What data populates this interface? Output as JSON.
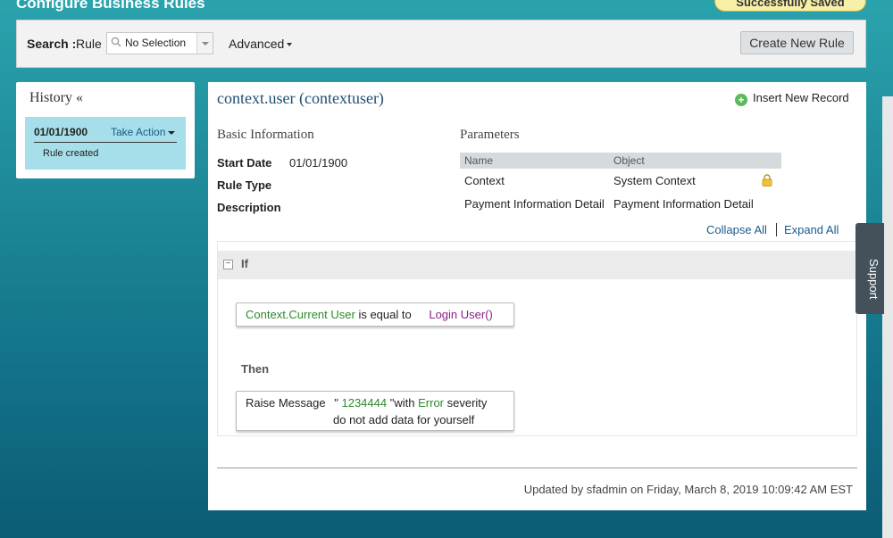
{
  "page": {
    "title": "Configure Business Rules",
    "saved_badge": "Successfully Saved"
  },
  "search": {
    "label": "Search :",
    "rule_label": "Rule",
    "select_value": "No Selection",
    "advanced_label": "Advanced",
    "create_button": "Create New Rule"
  },
  "history": {
    "title": "History «",
    "entry": {
      "date": "01/01/1900",
      "action": "Take Action",
      "note": "Rule created"
    }
  },
  "rule": {
    "title": "context.user (contextuser)",
    "insert_record": "Insert New Record",
    "basic_info": {
      "heading": "Basic Information",
      "start_date_label": "Start Date",
      "start_date_value": "01/01/1900",
      "rule_type_label": "Rule Type",
      "description_label": "Description"
    },
    "parameters": {
      "heading": "Parameters",
      "columns": [
        "Name",
        "Object"
      ],
      "rows": [
        [
          "Context",
          "System Context"
        ],
        [
          "Payment Information Detail",
          "Payment Information Detail"
        ]
      ]
    },
    "collapse_all": "Collapse All",
    "expand_all": "Expand All",
    "if_label": "If",
    "condition": {
      "left": "Context.Current User",
      "op": "is equal to",
      "right": "Login User()"
    },
    "then_label": "Then",
    "action": {
      "prefix": "Raise Message",
      "quote_open": "\"",
      "message": "1234444",
      "quote_close": "\"",
      "with": "with",
      "severity": "Error",
      "severity_suffix": "severity",
      "line2": "do not add data for yourself"
    },
    "footer": "Updated by sfadmin on Friday, March 8, 2019 10:09:42 AM EST"
  },
  "support": {
    "label": "Support"
  },
  "colors": {
    "accent": "#1d4f73",
    "green": "#2b8a2b",
    "purple": "#8b1f8b",
    "history_card": "#a6dfe9"
  }
}
